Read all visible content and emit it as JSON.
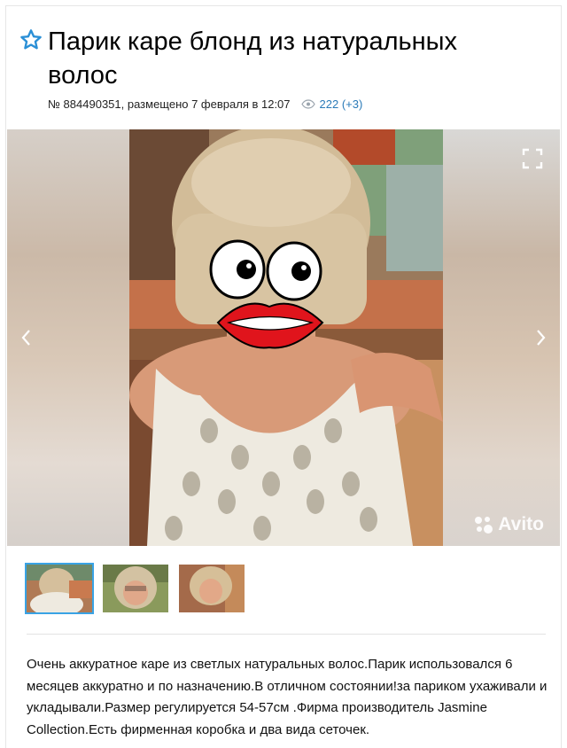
{
  "listing": {
    "title": "Парик каре блонд из натуральных волос",
    "meta": "№ 884490351, размещено 7 февраля в 12:07",
    "views": "222 (+3)",
    "favorite_icon": "star-outline-icon",
    "accent_color": "#2a7ab8"
  },
  "gallery": {
    "watermark": "Avito",
    "nav_prev_icon": "chevron-left-icon",
    "nav_next_icon": "chevron-right-icon",
    "fullscreen_icon": "expand-icon",
    "thumbnail_count": 3,
    "active_thumbnail": 1
  },
  "description": {
    "text": "Очень аккуратное каре из светлых натуральных волос.Парик использовался 6 месяцев аккуратно и по назначению.В отличном состоянии!за париком ухаживали и укладывали.Размер регулируется 54-57см .Фирма производитель Jasmine Collection.Есть фирменная коробка и два вида сеточек."
  }
}
